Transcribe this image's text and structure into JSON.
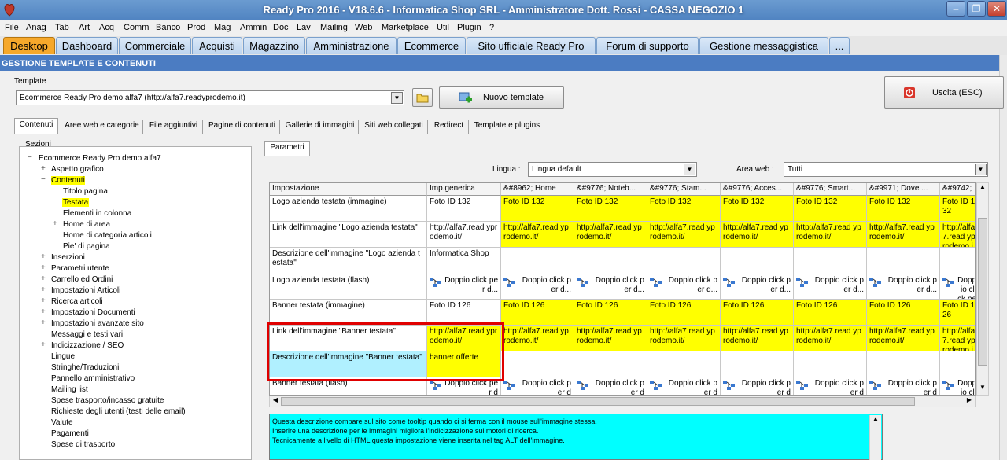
{
  "window": {
    "title": "Ready Pro 2016 - V18.6.6 - Informatica Shop SRL - Amministratore Dott. Rossi - CASSA NEGOZIO 1",
    "min": "–",
    "max": "❐",
    "close": "✕"
  },
  "menu": [
    "File",
    "Anag",
    "Tab",
    "Art",
    "Acq",
    "Comm",
    "Banco",
    "Prod",
    "Mag",
    "Ammin",
    "Doc",
    "Lav",
    "Mailing",
    "Web",
    "Marketplace",
    "Util",
    "Plugin",
    "?"
  ],
  "main_tabs": [
    "Desktop",
    "Dashboard",
    "Commerciale",
    "Acquisti",
    "Magazzino",
    "Amministrazione",
    "Ecommerce",
    "Sito ufficiale Ready Pro",
    "Forum di supporto",
    "Gestione messaggistica",
    "..."
  ],
  "section_title": "GESTIONE TEMPLATE E CONTENUTI",
  "template": {
    "label": "Template",
    "value": "Ecommerce Ready Pro demo alfa7 (http://alfa7.readyprodemo.it)",
    "new_button": "Nuovo template"
  },
  "exit_button": "Uscita (ESC)",
  "sub_tabs": [
    "Contenuti",
    "Aree web e categorie",
    "File aggiuntivi",
    "Pagine di contenuti",
    "Gallerie di immagini",
    "Siti web collegati",
    "Redirect",
    "Template e plugins"
  ],
  "tree": {
    "label": "Sezioni",
    "root": "Ecommerce Ready Pro demo alfa7",
    "items": {
      "aspetto": "Aspetto grafico",
      "contenuti": "Contenuti",
      "titolo": "Titolo pagina",
      "testata": "Testata",
      "elementi": "Elementi in colonna",
      "home_area": "Home di area",
      "home_cat": "Home di categoria articoli",
      "pie": "Pie' di pagina",
      "inserzioni": "Inserzioni",
      "parametri_utente": "Parametri utente",
      "carrello": "Carrello ed Ordini",
      "imp_articoli": "Impostazioni Articoli",
      "ricerca": "Ricerca articoli",
      "imp_documenti": "Impostazioni Documenti",
      "imp_avanzate": "Impostazioni avanzate sito",
      "messaggi": "Messaggi e testi vari",
      "indicizzazione": "Indicizzazione / SEO",
      "lingue": "Lingue",
      "stringhe": "Stringhe/Traduzioni",
      "pannello": "Pannello amministrativo",
      "mailing": "Mailing list",
      "spese": "Spese trasporto/incasso gratuite",
      "richieste": "Richieste degli utenti (testi delle email)",
      "valute": "Valute",
      "pagamenti": "Pagamenti",
      "spese_trasporto": "Spese di trasporto"
    }
  },
  "params_tab": "Parametri",
  "lingua": {
    "label": "Lingua :",
    "value": "Lingua default"
  },
  "area_web": {
    "label": "Area web :",
    "value": "Tutti"
  },
  "grid": {
    "headers": [
      "Impostazione",
      "Imp.generica",
      "&#8962; Home",
      "&#9776; Noteb...",
      "&#9776; Stam...",
      "&#9776; Acces...",
      "&#9776; Smart...",
      "&#9971; Dove ...",
      "&#9742; ..."
    ],
    "rows": [
      {
        "name": "Logo azienda testata (immagine)",
        "generic": "Foto ID 132",
        "val": "Foto ID 132"
      },
      {
        "name": "Link dell'immagine \"Logo azienda testata\"",
        "generic": "http://alfa7.read yprodemo.it/",
        "val": "http://alfa7.read yprodemo.it/"
      },
      {
        "name": "Descrizione dell'immagine \"Logo azienda testata\"",
        "generic": "Informatica Shop",
        "val": ""
      },
      {
        "name": "Logo azienda testata (flash)",
        "generic": "Doppio click per d...",
        "val": "Doppio click per d..."
      },
      {
        "name": "Banner testata (immagine)",
        "generic": "Foto ID 126",
        "val": "Foto ID 126"
      },
      {
        "name": "Link dell'immagine \"Banner testata\"",
        "generic": "http://alfa7.read yprodemo.it/",
        "val": "http://alfa7.read yprodemo.it/"
      },
      {
        "name": "Descrizione dell'immagine \"Banner testata\"",
        "generic": "banner offerte",
        "val": ""
      },
      {
        "name": "Banner testata (flash)",
        "generic": "Doppio click per d",
        "val": "Doppio click per d"
      }
    ]
  },
  "tooltip": {
    "line1": "Questa descrizione compare sul sito come tooltip quando ci si ferma con il mouse sull'immagine stessa.",
    "line2": "Inserire una descrizione per le immagini migliora l'indicizzazione sui motori di ricerca.",
    "line3": "Tecnicamente a livello di HTML questa impostazione viene inserita nel tag ALT dell'immagine."
  },
  "colors": {
    "accent_tab": "#f6a82b",
    "header_blue": "#4b7cc2",
    "highlight_yellow": "#ffff00",
    "tooltip_cyan": "#00ffff",
    "selection_red": "#e00000"
  }
}
